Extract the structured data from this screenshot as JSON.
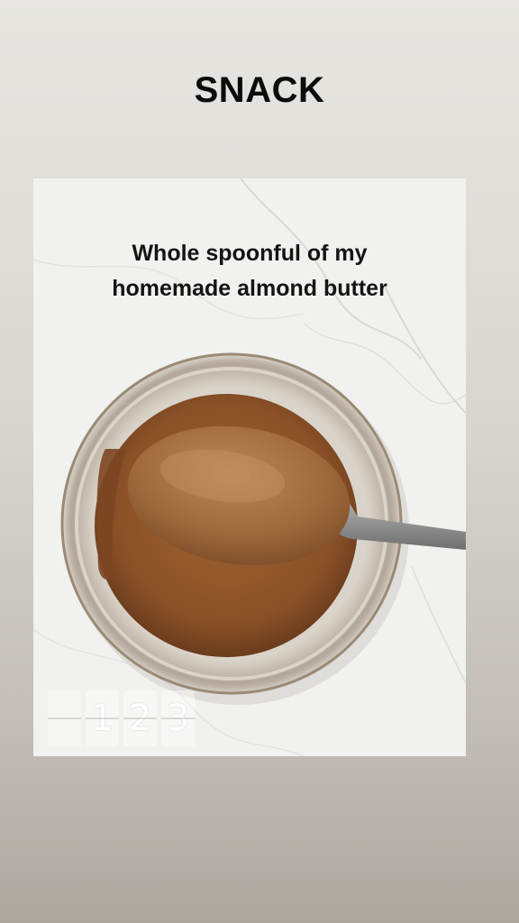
{
  "story": {
    "title": "SNACK"
  },
  "photo": {
    "caption_line1": "Whole spoonful of my",
    "caption_line2": "homemade almond butter"
  },
  "counter": {
    "digits": [
      "",
      "1",
      "2",
      "3"
    ]
  },
  "colors": {
    "almond_butter": "#8a5128",
    "marble": "#f1f1ef",
    "title_text": "#0c0c0c"
  }
}
